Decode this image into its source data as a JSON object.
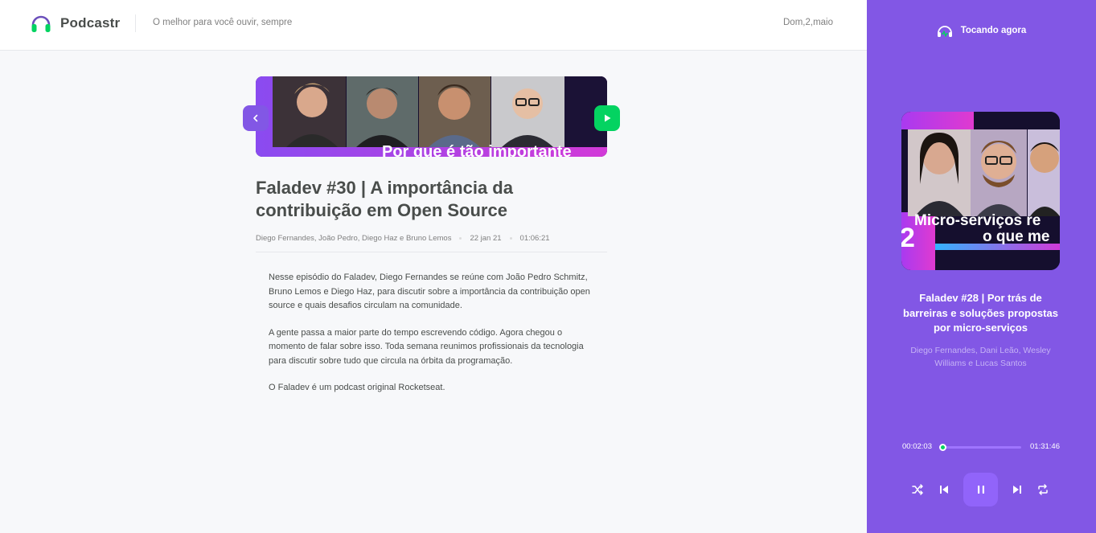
{
  "header": {
    "app_name": "Podcastr",
    "tagline": "O melhor para você ouvir, sempre",
    "date": "Dom,2,maio",
    "logo_icon": "headphones-icon"
  },
  "episode": {
    "thumbnail_caption": "Por que é tão importante",
    "title": "Faladev #30 | A importância da contribuição em Open Source",
    "members": "Diego Fernandes, João Pedro, Diego Haz e Bruno Lemos",
    "published_at": "22 jan 21",
    "duration": "01:06:21",
    "description": [
      "Nesse episódio do Faladev, Diego Fernandes se reúne com João Pedro Schmitz, Bruno Lemos e Diego Haz, para discutir sobre a importância da contribuição open source e quais desafios circulam na comunidade.",
      "A gente passa a maior parte do tempo escrevendo código. Agora chegou o momento de falar sobre isso. Toda semana reunimos profissionais da tecnologia para discutir sobre tudo que circula na órbita da programação.",
      "O Faladev é um podcast original Rocketseat."
    ]
  },
  "player": {
    "label": "Tocando agora",
    "cover_caption_line1": "Micro-serviços re",
    "cover_caption_line2": "o que me",
    "cover_number": "2",
    "title": "Faladev #28 | Por trás de barreiras e soluções propostas por micro-serviços",
    "members": "Diego Fernandes, Dani Leão, Wesley Williams e Lucas Santos",
    "current_time": "00:02:03",
    "total_time": "01:31:46",
    "progress": 0.02
  },
  "colors": {
    "purple": "#8257e5",
    "green": "#04d361",
    "text_dark": "#494d4b",
    "text_muted": "#808080"
  }
}
